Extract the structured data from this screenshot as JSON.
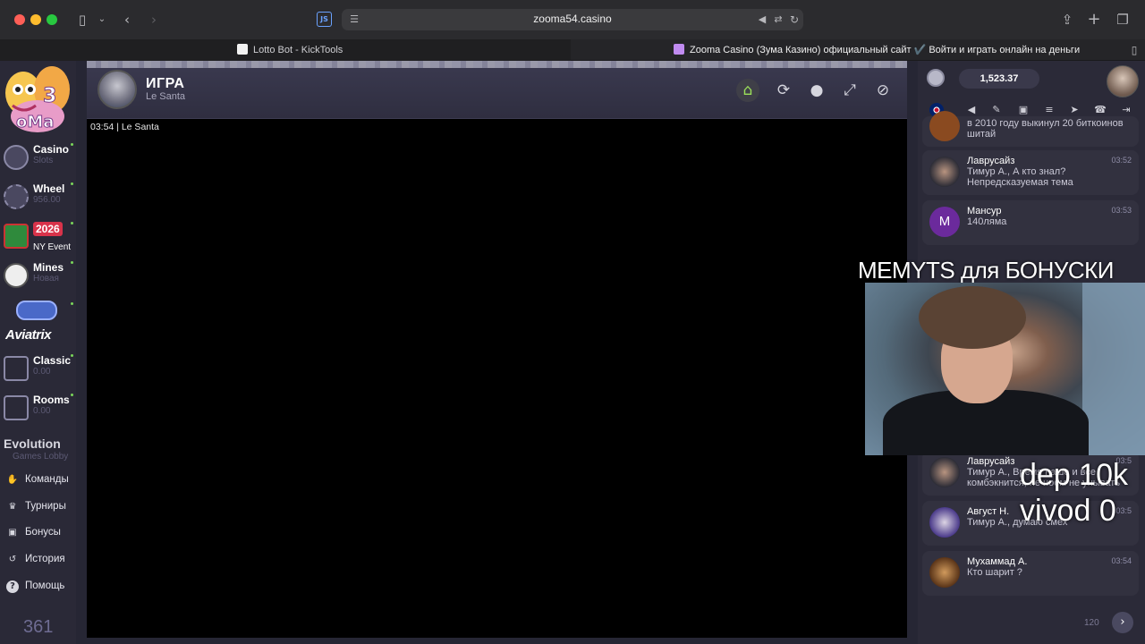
{
  "browser": {
    "url": "zooma54.casino",
    "js_badge": "JS",
    "tabs": [
      {
        "title": "Lotto Bot - KickTools"
      },
      {
        "title": "Zooma Casino (Зума Казино) официальный сайт ✔️ Войти и играть онлайн на деньги"
      }
    ]
  },
  "nav": {
    "items": [
      {
        "title": "Casino",
        "sub": "Slots"
      },
      {
        "title": "Wheel",
        "sub": "956.00"
      },
      {
        "title": "2026",
        "sub": "NY Event"
      },
      {
        "title": "Mines",
        "sub": "Новая"
      },
      {
        "title": "Aviatrix",
        "sub": ""
      },
      {
        "title": "Classic",
        "sub": "0.00"
      },
      {
        "title": "Rooms",
        "sub": "0.00"
      },
      {
        "title": "Evolution",
        "sub": "Games Lobby"
      }
    ],
    "links": [
      {
        "label": "Команды",
        "icon": "handshake-icon"
      },
      {
        "label": "Турниры",
        "icon": "trophy-icon"
      },
      {
        "label": "Бонусы",
        "icon": "gift-icon"
      },
      {
        "label": "История",
        "icon": "history-icon"
      },
      {
        "label": "Помощь",
        "icon": "help-icon"
      }
    ],
    "counter": "361"
  },
  "game": {
    "title": "ИГРА",
    "subtitle": "Le Santa",
    "overlay": "03:54 | Le Santa"
  },
  "right": {
    "balance": "1,523.37",
    "chat": [
      {
        "name": "",
        "time": "",
        "line1": "в 2010 году выкинул 20 биткоинов",
        "line2": "шитай"
      },
      {
        "name": "Лаврусайз",
        "time": "03:52",
        "line1": "Тимур А., А кто знал?",
        "line2": "Непредсказуемая тема"
      },
      {
        "name": "Мансур",
        "time": "03:53",
        "line1": "140ляма",
        "line2": "",
        "avatar_letter": "M"
      },
      {
        "name": "Лаврусайз",
        "time": "03:5",
        "line1": "Тимур А., Время наше и все",
        "line2": "комбэкнится, не ноем не унывать"
      },
      {
        "name": "Август Н.",
        "time": "03:5",
        "line1": "Тимур А., думаю смех",
        "line2": ""
      },
      {
        "name": "Мухаммад А.",
        "time": "03:54",
        "line1": "Кто шарит ?",
        "line2": ""
      }
    ],
    "char_count": "120"
  },
  "stream": {
    "banner": "MEMYTS для БОНУСКИ",
    "dep": "dep 10k",
    "vivod": "vivod 0"
  },
  "colors": {
    "accent_green": "#9be05a",
    "brand_purple": "#6b2a9c"
  }
}
